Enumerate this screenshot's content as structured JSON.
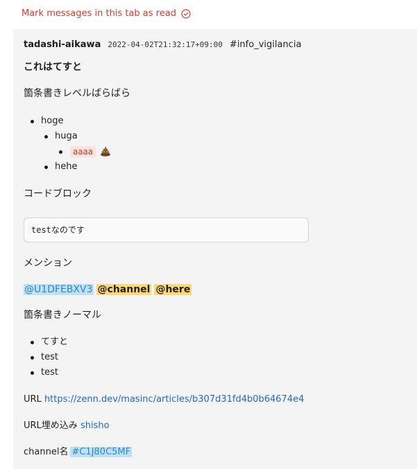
{
  "mark_read": {
    "label": "Mark messages in this tab as read",
    "icon": "check-circle-icon"
  },
  "message": {
    "author": "tadashi-aikawa",
    "timestamp": "2022-04-02T21:32:17+09:00",
    "channel": "#info_vigilancia",
    "title": "これはてすと",
    "section_bullets_levels": "箇条書きレベルばらばら",
    "nested_list": {
      "item1": "hoge",
      "item1_1": "huga",
      "item1_1_1_code": "aaaa",
      "item1_1_1_emoji": "poop-icon",
      "item1_2": "hehe"
    },
    "section_codeblock": "コードブロック",
    "code": "testなのです",
    "section_mention": "メンション",
    "mention_user": "@U1DFEBXV3",
    "mention_channel": "@channel",
    "mention_here": "@here",
    "section_bullets_normal": "箇条書きノーマル",
    "normal_list": [
      "てすと",
      "test",
      "test"
    ],
    "url_label": "URL",
    "url": "https://zenn.dev/masinc/articles/b307d31fd4b0b64674e4",
    "url_embed_label": "URL埋め込み",
    "url_embed_text": "shisho",
    "channel_label": "channel名",
    "channel_link": "#C1J80C5MF"
  },
  "colors": {
    "mark_read": "#d83b2b",
    "message_bg": "#f4f4f4",
    "link": "#1e69c6",
    "mention_user_bg": "#bfe1f5",
    "mention_special_bg": "#fcd977",
    "inline_code_bg": "#f9e3dc"
  }
}
